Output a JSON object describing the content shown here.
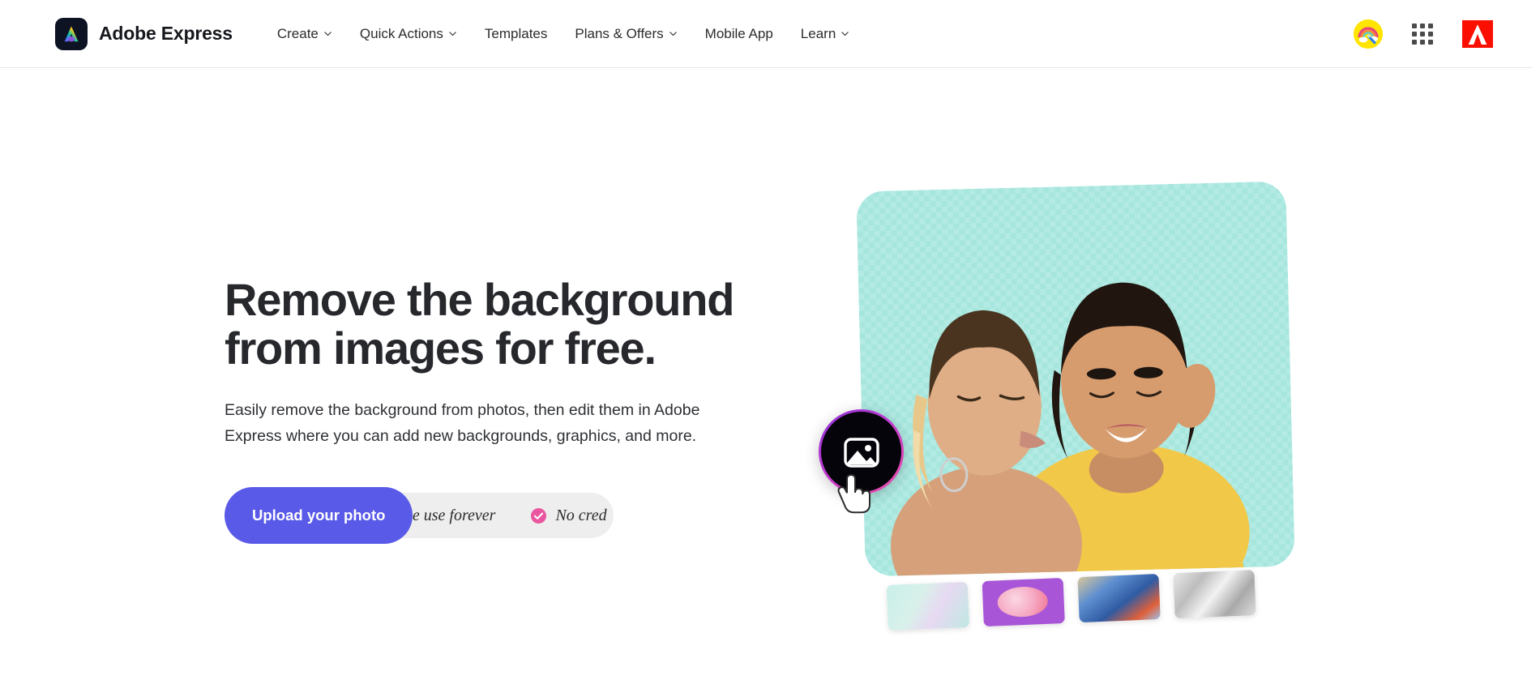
{
  "header": {
    "brand_name": "Adobe Express",
    "brand_logo_icon": "adobe-express-logo",
    "nav": [
      {
        "label": "Create",
        "has_chevron": true
      },
      {
        "label": "Quick Actions",
        "has_chevron": true
      },
      {
        "label": "Templates",
        "has_chevron": false
      },
      {
        "label": "Plans & Offers",
        "has_chevron": true
      },
      {
        "label": "Mobile App",
        "has_chevron": false
      },
      {
        "label": "Learn",
        "has_chevron": true
      }
    ],
    "avatar_icon": "user-avatar-rainbow",
    "app_switcher_icon": "app-grid-icon",
    "adobe_logo_icon": "adobe-logo"
  },
  "hero": {
    "headline_line1": "Remove the background",
    "headline_line2": "from images for free.",
    "subcopy": "Easily remove the background from photos, then edit them in Adobe Express where you can add new backgrounds, graphics, and more.",
    "cta_label": "Upload your photo",
    "benefits": [
      {
        "text": "ee use forever",
        "icon": ""
      },
      {
        "text": "No cred",
        "icon": "check-circle-icon"
      }
    ]
  },
  "art": {
    "shutter_icon": "image-photo-icon",
    "cursor_icon": "hand-pointer-cursor",
    "thumbnails": [
      {
        "name": "thumbnail-holographic"
      },
      {
        "name": "thumbnail-purple-blob"
      },
      {
        "name": "thumbnail-blue-floral"
      },
      {
        "name": "thumbnail-silver-texture"
      }
    ]
  },
  "colors": {
    "cta_purple": "#5A5AE8",
    "check_pink": "#EA57A0",
    "pill_gray": "#EEEEEE",
    "photo_mint": "#A9E7DF",
    "adobe_red": "#FA0F00",
    "headline_dark": "#26282C"
  }
}
